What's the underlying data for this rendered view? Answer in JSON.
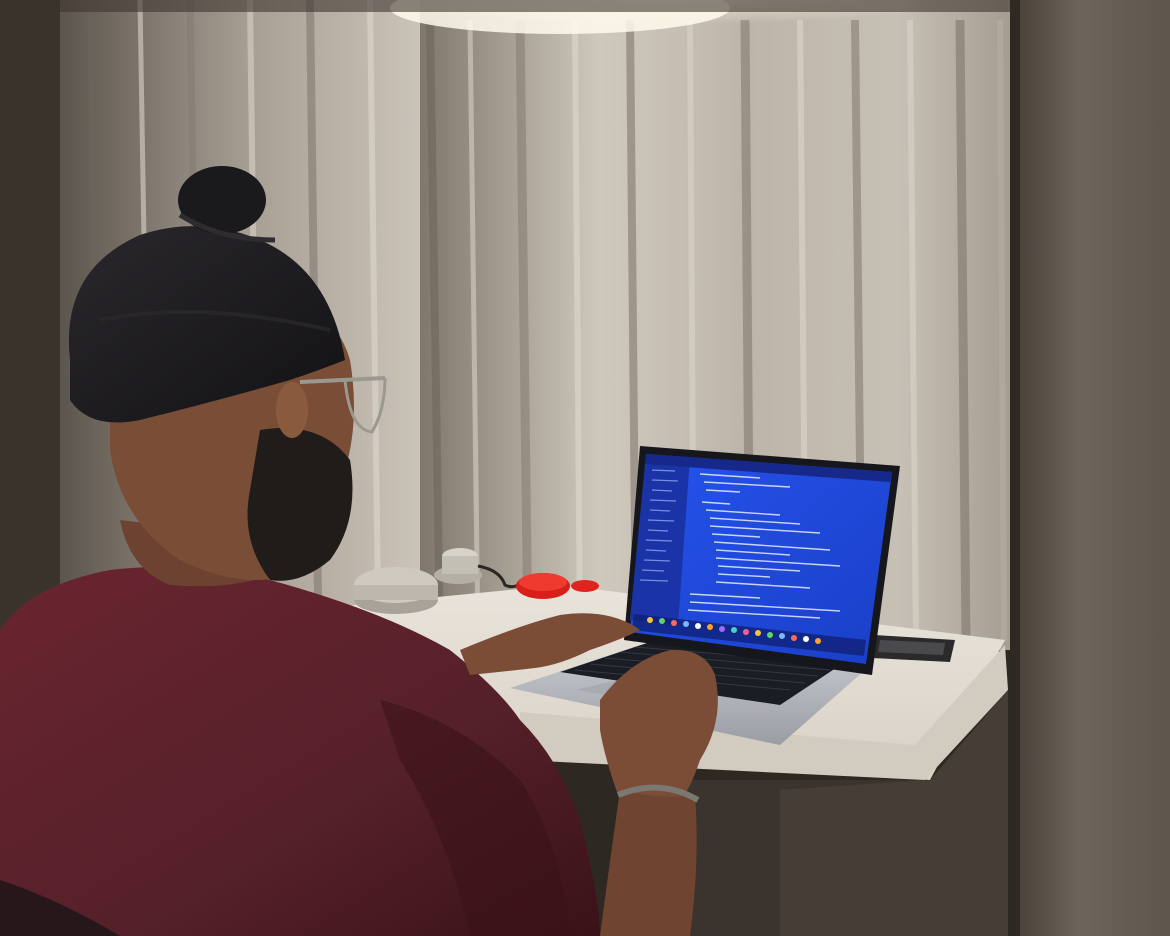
{
  "scene": {
    "description_tags": [
      "person",
      "laptop",
      "desk",
      "curtain",
      "led-light",
      "smart-speaker",
      "code-editor"
    ],
    "colors": {
      "wall_left": "#3a332c",
      "wall_right": "#5a5148",
      "curtain_light": "#d8d2c8",
      "curtain_mid": "#a69e92",
      "curtain_dark": "#6e675d",
      "desk_top": "#ebe7e0",
      "desk_front": "#cfc9c0",
      "cabinet": "#3b342e",
      "shirt": "#5a1d24",
      "shirt_shadow": "#3a1016",
      "turban": "#1c1b1e",
      "skin": "#8a5a3c",
      "beard": "#24201c",
      "laptop_body": "#b9bcc2",
      "keyboard": "#1a1d24",
      "screen_bg": "#1f49d9",
      "sidebar": "#1a34a8",
      "code_text": "#e8ecff",
      "led_glow": "#fff8e6",
      "speaker": "#c9c4ba",
      "red_item": "#e0231e",
      "bracelet": "#7a7870"
    }
  }
}
